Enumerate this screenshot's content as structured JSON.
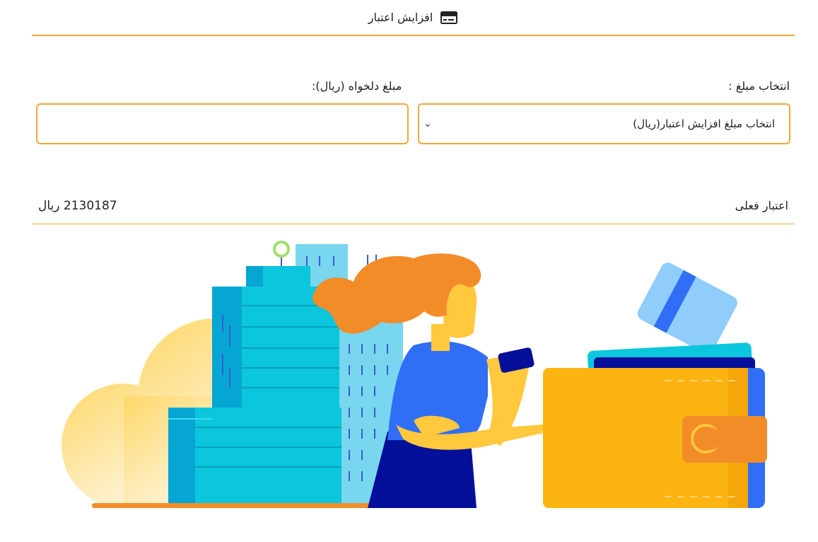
{
  "header": {
    "title": "افزایش اعتبار",
    "icon": "credit-card-icon"
  },
  "form": {
    "select_label": "انتخاب مبلغ :",
    "select_value": "انتخاب مبلغ افزایش اعتبار(ریال)",
    "custom_label": "مبلغ دلخواه (ریال):",
    "custom_value": ""
  },
  "credit": {
    "label": "اعتبار فعلی",
    "amount": "2130187",
    "unit": "ریال"
  },
  "colors": {
    "accent": "#f0a83c",
    "wallet": "#fcb412",
    "card_blue": "#2f6ef5",
    "building_teal": "#0bc6dc"
  },
  "illustration": {
    "icon": "wallet-payment-illustration"
  }
}
